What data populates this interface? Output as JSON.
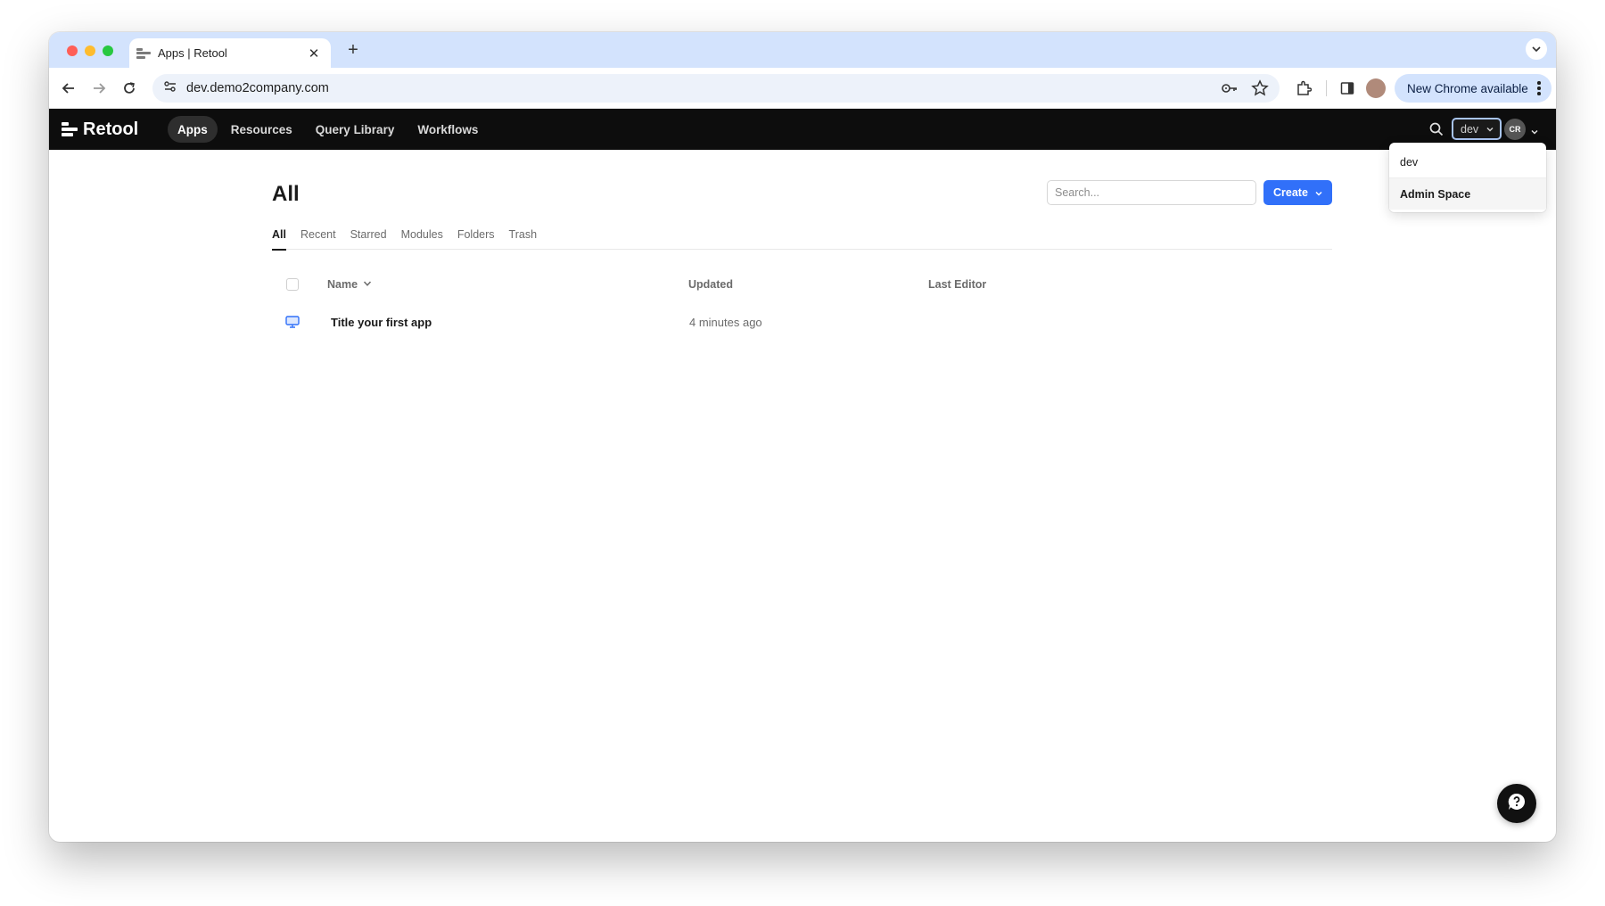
{
  "browser": {
    "tab_title": "Apps | Retool",
    "url": "dev.demo2company.com",
    "update_button": "New Chrome available"
  },
  "retool": {
    "logo_text": "Retool",
    "nav": [
      {
        "label": "Apps",
        "active": true
      },
      {
        "label": "Resources",
        "active": false
      },
      {
        "label": "Query Library",
        "active": false
      },
      {
        "label": "Workflows",
        "active": false
      }
    ],
    "env_selector": "dev",
    "avatar_initials": "CR",
    "env_menu": [
      {
        "label": "dev"
      },
      {
        "label": "Admin Space"
      }
    ]
  },
  "main": {
    "title": "All",
    "search_placeholder": "Search...",
    "create_label": "Create",
    "tabs": [
      {
        "label": "All",
        "active": true
      },
      {
        "label": "Recent"
      },
      {
        "label": "Starred"
      },
      {
        "label": "Modules"
      },
      {
        "label": "Folders"
      },
      {
        "label": "Trash"
      }
    ],
    "table": {
      "columns": [
        "Name",
        "Updated",
        "Last Editor"
      ],
      "rows": [
        {
          "name": "Title your first app",
          "updated": "4 minutes ago",
          "last_editor": ""
        }
      ]
    }
  },
  "colors": {
    "accent": "#3170f9",
    "header_bg": "#0d0d0d",
    "tabstrip_bg": "#d3e3fd"
  }
}
